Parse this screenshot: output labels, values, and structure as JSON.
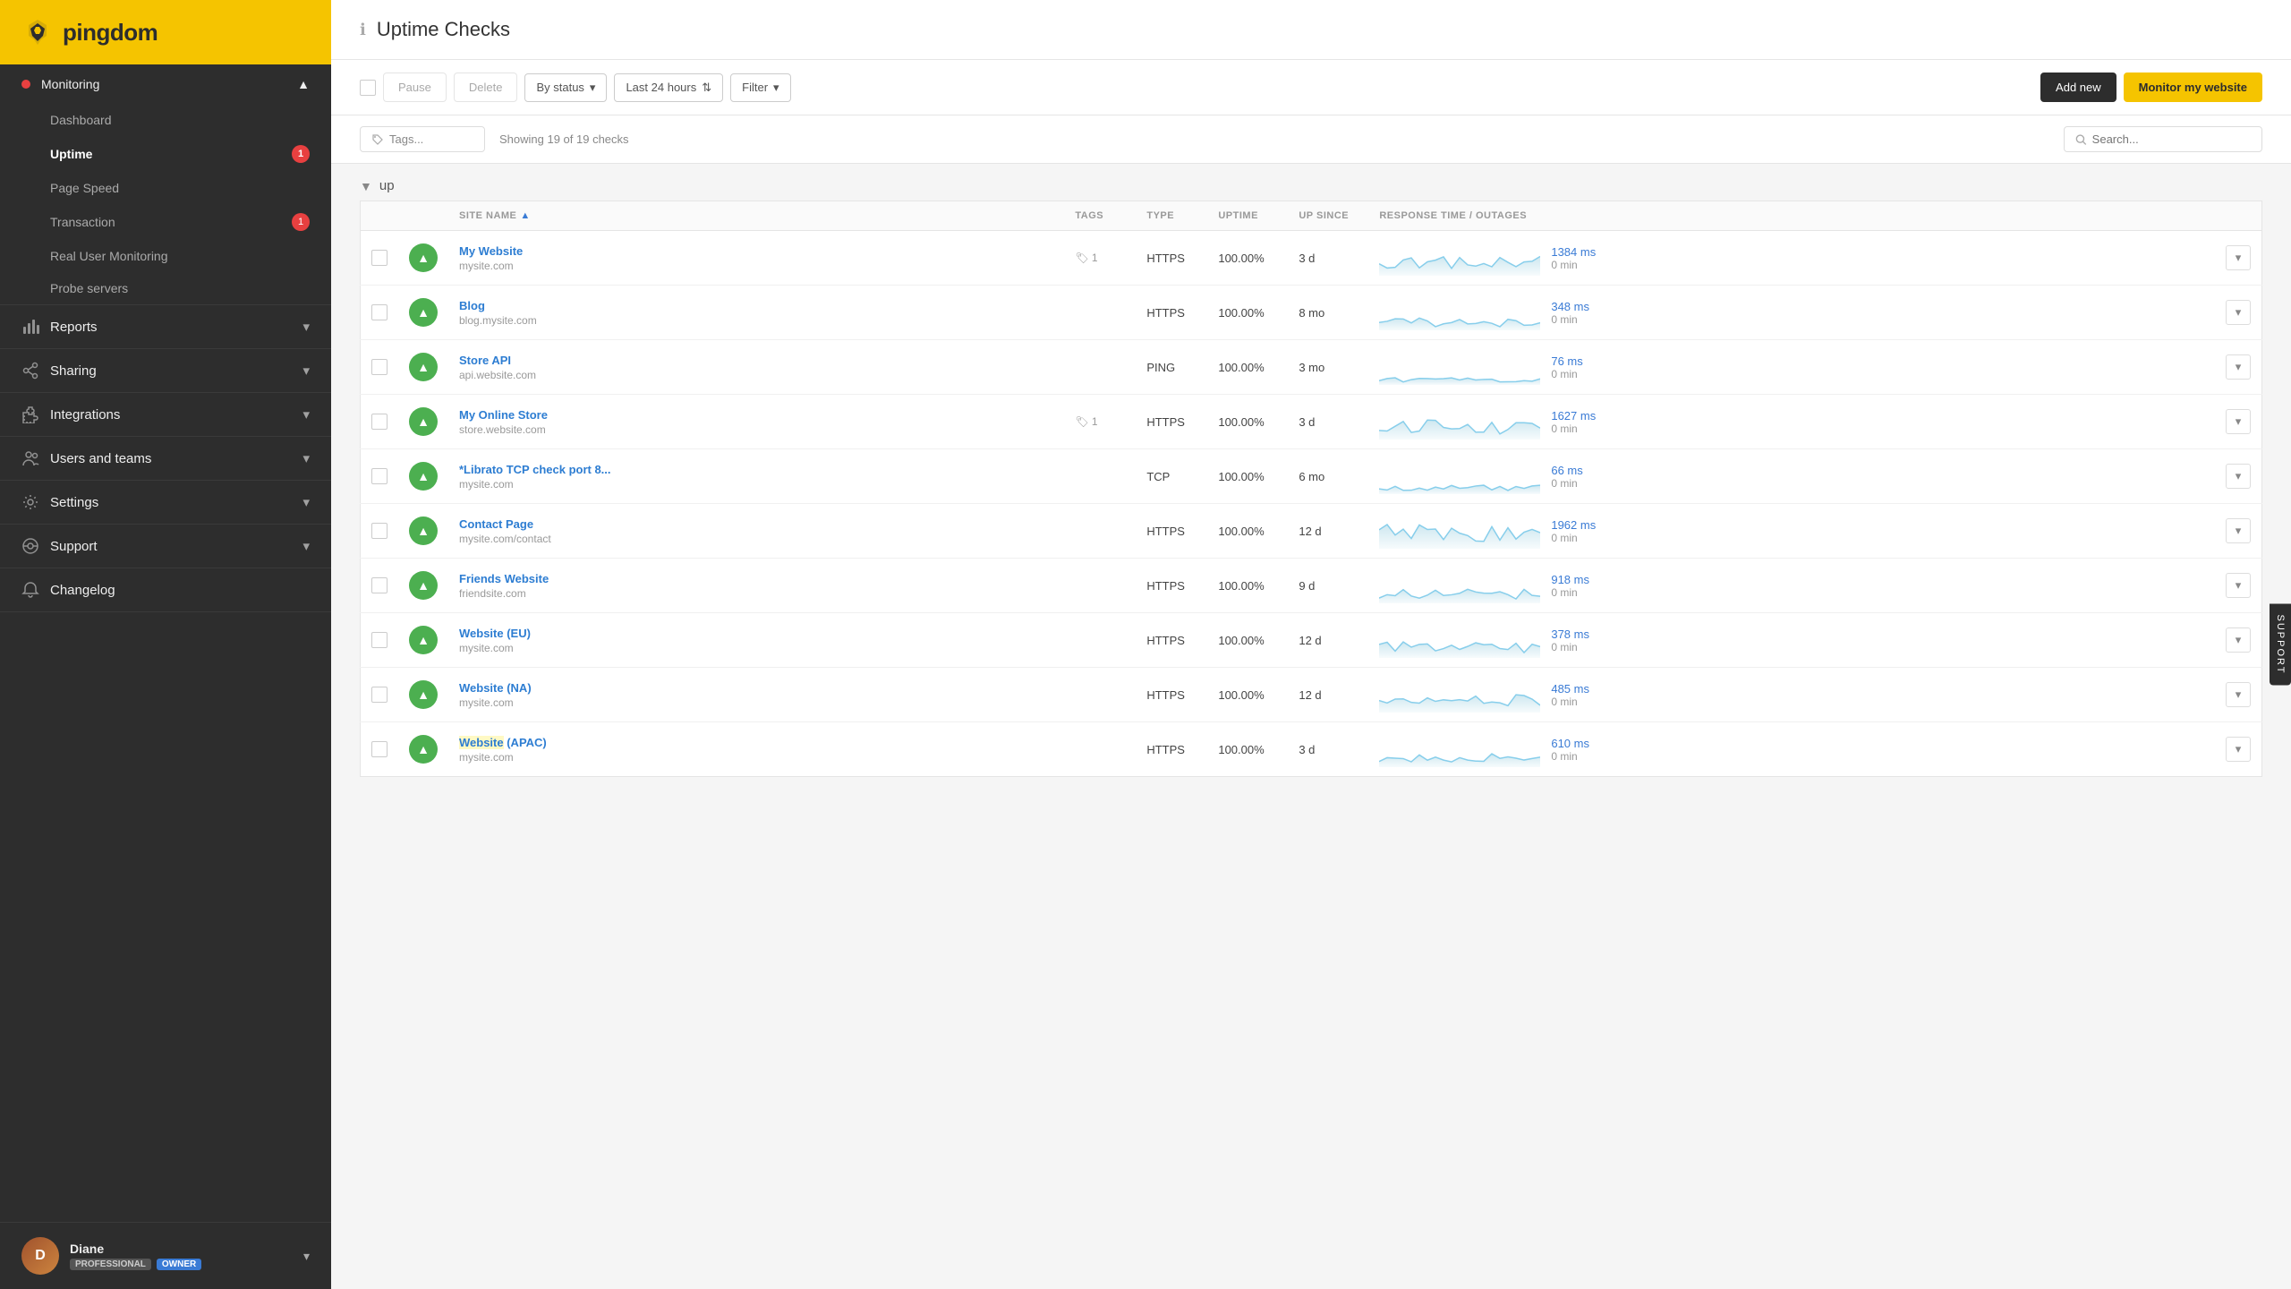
{
  "sidebar": {
    "logo": "pingdom",
    "monitoring": {
      "label": "Monitoring",
      "items": [
        {
          "id": "dashboard",
          "label": "Dashboard",
          "active": false,
          "badge": null
        },
        {
          "id": "uptime",
          "label": "Uptime",
          "active": true,
          "badge": 1
        },
        {
          "id": "page-speed",
          "label": "Page Speed",
          "active": false,
          "badge": null
        },
        {
          "id": "transaction",
          "label": "Transaction",
          "active": false,
          "badge": 1
        },
        {
          "id": "real-user-monitoring",
          "label": "Real User Monitoring",
          "active": false,
          "badge": null
        },
        {
          "id": "probe-servers",
          "label": "Probe servers",
          "active": false,
          "badge": null
        }
      ]
    },
    "nav": [
      {
        "id": "reports",
        "label": "Reports",
        "icon": "chart-icon"
      },
      {
        "id": "sharing",
        "label": "Sharing",
        "icon": "share-icon"
      },
      {
        "id": "integrations",
        "label": "Integrations",
        "icon": "puzzle-icon"
      },
      {
        "id": "users-and-teams",
        "label": "Users and teams",
        "icon": "users-icon"
      },
      {
        "id": "settings",
        "label": "Settings",
        "icon": "gear-icon"
      },
      {
        "id": "support",
        "label": "Support",
        "icon": "support-icon"
      },
      {
        "id": "changelog",
        "label": "Changelog",
        "icon": "bell-icon"
      }
    ],
    "user": {
      "name": "Diane",
      "badge_professional": "PROFESSIONAL",
      "badge_owner": "OWNER"
    }
  },
  "main": {
    "title": "Uptime Checks",
    "toolbar": {
      "pause_label": "Pause",
      "delete_label": "Delete",
      "by_status_label": "By status",
      "last_24h_label": "Last 24 hours",
      "filter_label": "Filter",
      "add_new_label": "Add new",
      "monitor_label": "Monitor my website"
    },
    "filter_bar": {
      "tags_placeholder": "Tags...",
      "showing_text": "Showing 19 of 19 checks",
      "search_placeholder": "Search..."
    },
    "group_label": "up",
    "columns": [
      "",
      "",
      "SITE NAME",
      "TAGS",
      "TYPE",
      "UPTIME",
      "UP SINCE",
      "RESPONSE TIME / OUTAGES",
      ""
    ],
    "checks": [
      {
        "name": "My Website",
        "url": "mysite.com",
        "tags": 1,
        "type": "HTTPS",
        "uptime": "100.00%",
        "up_since": "3 d",
        "response_ms": "1384 ms",
        "outage": "0 min",
        "spark_high": 60,
        "spark_low": 20
      },
      {
        "name": "Blog",
        "url": "blog.mysite.com",
        "tags": 0,
        "type": "HTTPS",
        "uptime": "100.00%",
        "up_since": "8 mo",
        "response_ms": "348 ms",
        "outage": "0 min",
        "spark_high": 35,
        "spark_low": 10
      },
      {
        "name": "Store API",
        "url": "api.website.com",
        "tags": 0,
        "type": "PING",
        "uptime": "100.00%",
        "up_since": "3 mo",
        "response_ms": "76 ms",
        "outage": "0 min",
        "spark_high": 20,
        "spark_low": 8
      },
      {
        "name": "My Online Store",
        "url": "store.website.com",
        "tags": 1,
        "type": "HTTPS",
        "uptime": "100.00%",
        "up_since": "3 d",
        "response_ms": "1627 ms",
        "outage": "0 min",
        "spark_high": 55,
        "spark_low": 15
      },
      {
        "name": "*Librato TCP check port 8...",
        "url": "mysite.com",
        "tags": 0,
        "type": "TCP",
        "uptime": "100.00%",
        "up_since": "6 mo",
        "response_ms": "66 ms",
        "outage": "0 min",
        "spark_high": 25,
        "spark_low": 10
      },
      {
        "name": "Contact Page",
        "url": "mysite.com/contact",
        "tags": 0,
        "type": "HTTPS",
        "uptime": "100.00%",
        "up_since": "12 d",
        "response_ms": "1962 ms",
        "outage": "0 min",
        "spark_high": 70,
        "spark_low": 20
      },
      {
        "name": "Friends Website",
        "url": "friendsite.com",
        "tags": 0,
        "type": "HTTPS",
        "uptime": "100.00%",
        "up_since": "9 d",
        "response_ms": "918 ms",
        "outage": "0 min",
        "spark_high": 40,
        "spark_low": 12
      },
      {
        "name": "Website (EU)",
        "url": "mysite.com",
        "tags": 0,
        "type": "HTTPS",
        "uptime": "100.00%",
        "up_since": "12 d",
        "response_ms": "378 ms",
        "outage": "0 min",
        "spark_high": 45,
        "spark_low": 15
      },
      {
        "name": "Website (NA)",
        "url": "mysite.com",
        "tags": 0,
        "type": "HTTPS",
        "uptime": "100.00%",
        "up_since": "12 d",
        "response_ms": "485 ms",
        "outage": "0 min",
        "spark_high": 50,
        "spark_low": 18
      },
      {
        "name": "Website (APAC)",
        "url": "mysite.com",
        "tags": 0,
        "type": "HTTPS",
        "uptime": "100.00%",
        "up_since": "3 d",
        "response_ms": "610 ms",
        "outage": "0 min",
        "spark_high": 38,
        "spark_low": 14,
        "name_highlight": "Website"
      }
    ]
  },
  "support_tab": "SUPPORT"
}
